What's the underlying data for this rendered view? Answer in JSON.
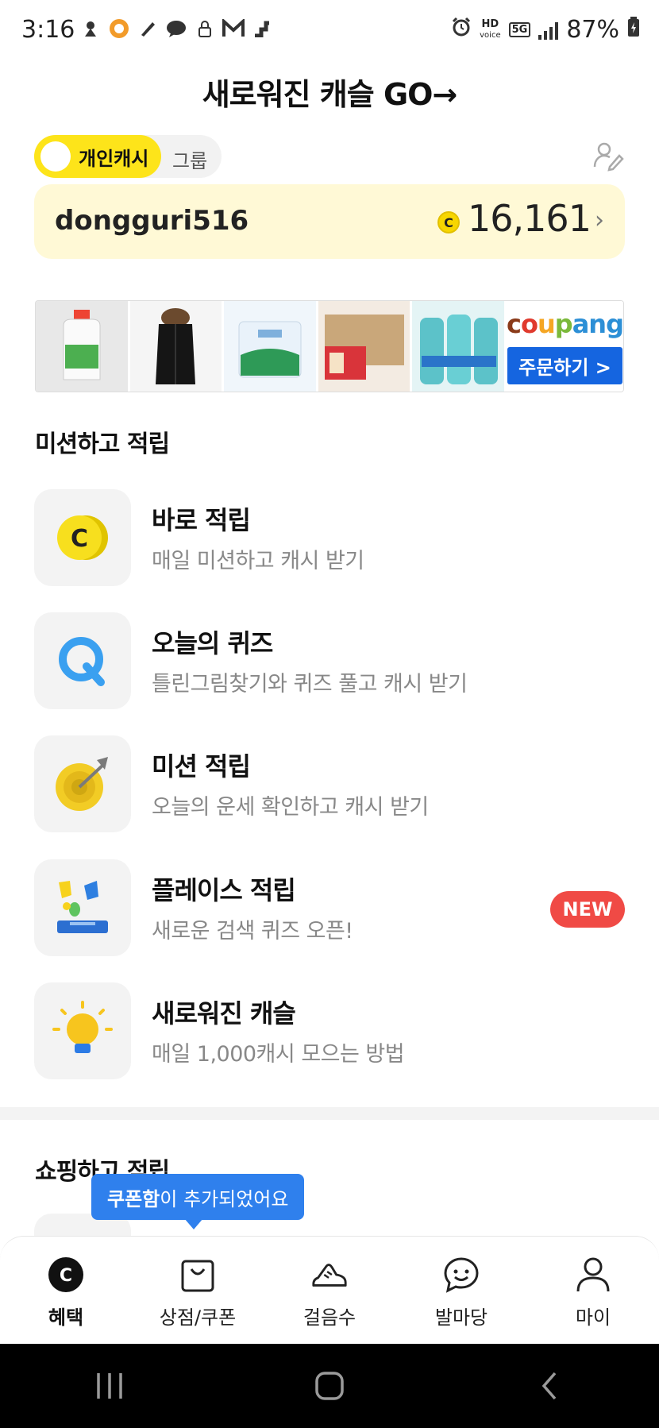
{
  "status_bar": {
    "time": "3:16",
    "hd_label": "HD",
    "voice_label": "voice",
    "network": "5G",
    "battery": "87%"
  },
  "header": {
    "title": "새로워진 캐슬  GO→"
  },
  "account_toggle": {
    "active_label": "개인캐시",
    "inactive_label": "그룹"
  },
  "balance": {
    "username": "dongguri516",
    "coin_symbol": "C",
    "amount": "16,161",
    "chevron": "›"
  },
  "ad": {
    "brand": [
      "c",
      "o",
      "u",
      "p",
      "ang"
    ],
    "order_button": "주문하기 >"
  },
  "missions_section": {
    "title": "미션하고 적립",
    "items": [
      {
        "title": "바로 적립",
        "desc": "매일 미션하고 캐시 받기",
        "icon": "coin-icon"
      },
      {
        "title": "오늘의 퀴즈",
        "desc": "틀린그림찾기와 퀴즈 풀고 캐시 받기",
        "icon": "quiz-icon"
      },
      {
        "title": "미션 적립",
        "desc": "오늘의 운세 확인하고 캐시 받기",
        "icon": "target-icon"
      },
      {
        "title": "플레이스 적립",
        "desc": "새로운 검색 퀴즈 오픈!",
        "icon": "place-icon",
        "badge": "NEW"
      },
      {
        "title": "새로워진 캐슬",
        "desc": "매일 1,000캐시 모으는 방법",
        "icon": "lightbulb-icon"
      }
    ]
  },
  "shopping_section": {
    "title": "쇼핑하고 적립"
  },
  "tooltip": {
    "bold": "쿠폰함",
    "text": "이 추가되었어요"
  },
  "bottom_nav": {
    "items": [
      {
        "label": "혜택",
        "active": true
      },
      {
        "label": "상점/쿠폰"
      },
      {
        "label": "걸음수"
      },
      {
        "label": "발마당"
      },
      {
        "label": "마이"
      }
    ]
  },
  "colors": {
    "accent_yellow": "#fde41a",
    "card_bg": "#fff9d6",
    "new_badge": "#f04a45",
    "tooltip_blue": "#2f80ed",
    "coupang_blue": "#1565e0"
  }
}
